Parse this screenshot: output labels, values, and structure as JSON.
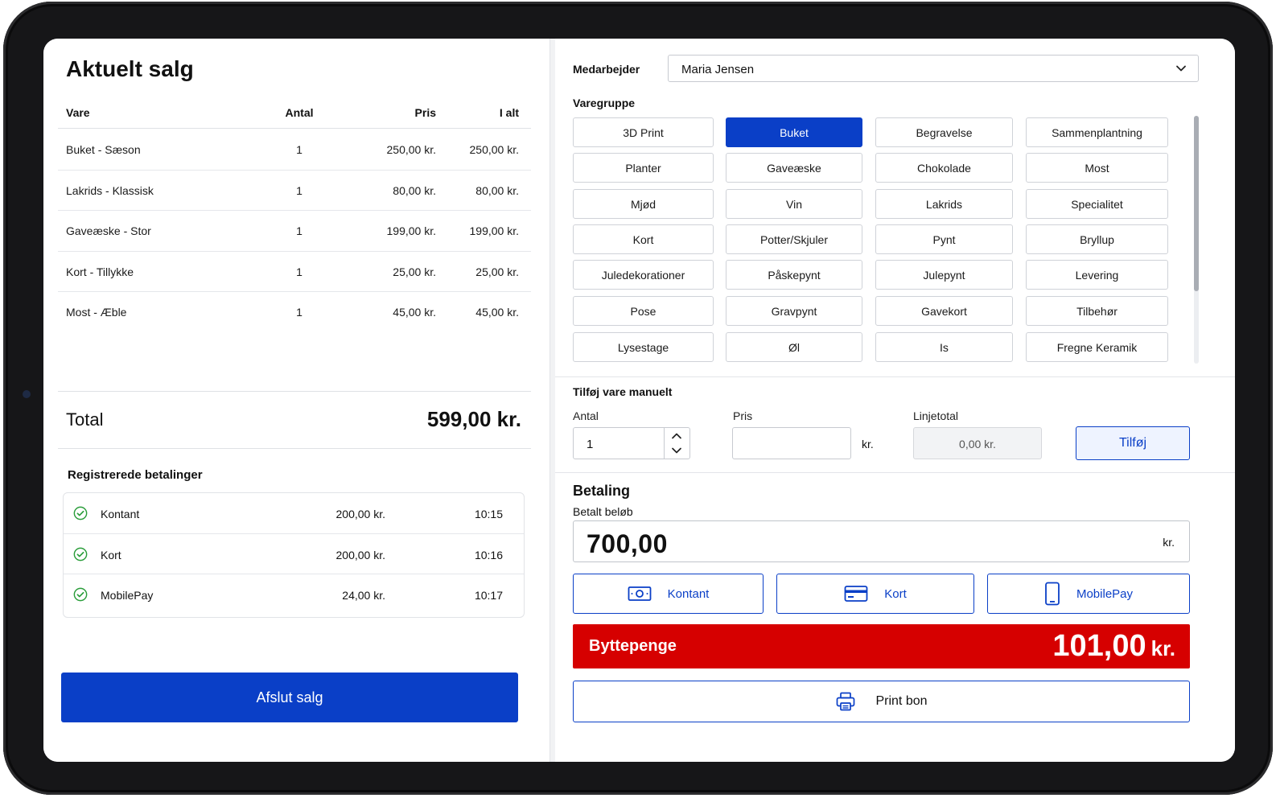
{
  "sale": {
    "title": "Aktuelt salg",
    "columns": {
      "item": "Vare",
      "qty": "Antal",
      "price": "Pris",
      "total": "I alt"
    },
    "rows": [
      {
        "item": "Buket - Sæson",
        "qty": "1",
        "price": "250,00 kr.",
        "total": "250,00 kr."
      },
      {
        "item": "Lakrids - Klassisk",
        "qty": "1",
        "price": "80,00 kr.",
        "total": "80,00 kr."
      },
      {
        "item": "Gaveæske - Stor",
        "qty": "1",
        "price": "199,00 kr.",
        "total": "199,00 kr."
      },
      {
        "item": "Kort - Tillykke",
        "qty": "1",
        "price": "25,00 kr.",
        "total": "25,00 kr."
      },
      {
        "item": "Most - Æble",
        "qty": "1",
        "price": "45,00 kr.",
        "total": "45,00 kr."
      }
    ],
    "total_label": "Total",
    "total_value": "599,00 kr."
  },
  "payments": {
    "title": "Registrerede betalinger",
    "rows": [
      {
        "method": "Kontant",
        "amount": "200,00 kr.",
        "time": "10:15"
      },
      {
        "method": "Kort",
        "amount": "200,00 kr.",
        "time": "10:16"
      },
      {
        "method": "MobilePay",
        "amount": "24,00 kr.",
        "time": "10:17"
      }
    ]
  },
  "finish_label": "Afslut salg",
  "employee": {
    "label": "Medarbejder",
    "value": "Maria Jensen"
  },
  "groups": {
    "label": "Varegruppe",
    "active": "Buket",
    "items": [
      "3D Print",
      "Buket",
      "Begravelse",
      "Sammenplantning",
      "Planter",
      "Gaveæske",
      "Chokolade",
      "Most",
      "Mjød",
      "Vin",
      "Lakrids",
      "Specialitet",
      "Kort",
      "Potter/Skjuler",
      "Pynt",
      "Bryllup",
      "Juledekorationer",
      "Påskepynt",
      "Julepynt",
      "Levering",
      "Pose",
      "Gravpynt",
      "Gavekort",
      "Tilbehør",
      "Lysestage",
      "Øl",
      "Is",
      "Fregne Keramik"
    ]
  },
  "manual": {
    "title": "Tilføj vare manuelt",
    "qty_label": "Antal",
    "qty_value": "1",
    "price_label": "Pris",
    "price_unit": "kr.",
    "line_label": "Linjetotal",
    "line_value": "0,00 kr.",
    "add_label": "Tilføj"
  },
  "payment": {
    "title": "Betaling",
    "paid_label": "Betalt beløb",
    "paid_value": "700,00",
    "paid_unit": "kr.",
    "methods": {
      "cash": "Kontant",
      "card": "Kort",
      "mobile": "MobilePay"
    },
    "change_label": "Byttepenge",
    "change_value": "101,00",
    "change_unit": "kr.",
    "print_label": "Print bon"
  },
  "colors": {
    "accent": "#0a3fc7",
    "change": "#d60000",
    "success": "#2a9d3a"
  },
  "icons": {
    "check": "check-circle-icon",
    "cash": "cash-icon",
    "card": "credit-card-icon",
    "mobile": "phone-icon",
    "print": "printer-icon",
    "dropdown": "chevron-down-icon"
  }
}
